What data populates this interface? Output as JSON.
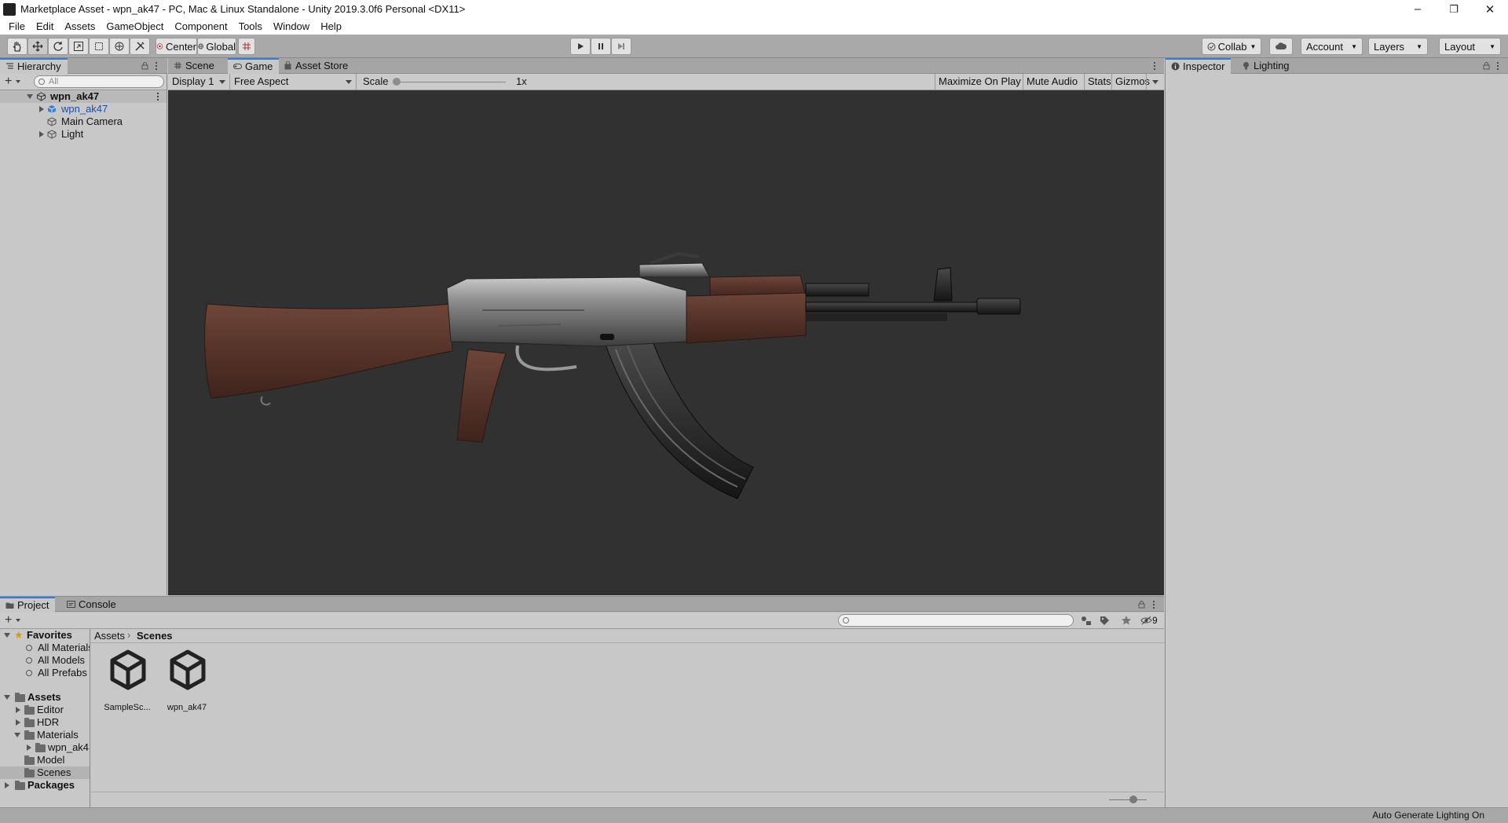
{
  "window": {
    "title": "Marketplace Asset - wpn_ak47 - PC, Mac & Linux Standalone - Unity 2019.3.0f6 Personal <DX11>",
    "controls": {
      "minimize": "–",
      "maximize": "❐",
      "close": "✕"
    }
  },
  "menu": [
    "File",
    "Edit",
    "Assets",
    "GameObject",
    "Component",
    "Tools",
    "Window",
    "Help"
  ],
  "toolbar": {
    "pivot_mode": "Center",
    "pivot_rotation": "Global",
    "collab": "Collab",
    "account": "Account",
    "layers": "Layers",
    "layout": "Layout"
  },
  "hierarchy": {
    "tab": "Hierarchy",
    "search_placeholder": "All",
    "scene": "wpn_ak47",
    "items": [
      {
        "label": "wpn_ak47",
        "prefab": true,
        "expandable": true
      },
      {
        "label": "Main Camera",
        "prefab": false,
        "expandable": false
      },
      {
        "label": "Light",
        "prefab": false,
        "expandable": true
      }
    ]
  },
  "center_tabs": [
    "Scene",
    "Game",
    "Asset Store"
  ],
  "center_active_tab": "Game",
  "game_toolbar": {
    "display": "Display 1",
    "aspect": "Free Aspect",
    "scale_label": "Scale",
    "scale_value": "1x",
    "maximize_on_play": "Maximize On Play",
    "mute_audio": "Mute Audio",
    "stats": "Stats",
    "gizmos": "Gizmos"
  },
  "right_tabs": [
    "Inspector",
    "Lighting"
  ],
  "project": {
    "tabs": [
      "Project",
      "Console"
    ],
    "hidden_count": "9",
    "favorites": {
      "label": "Favorites",
      "items": [
        "All Materials",
        "All Models",
        "All Prefabs"
      ]
    },
    "assets": {
      "label": "Assets",
      "folders": [
        {
          "label": "Editor",
          "children": []
        },
        {
          "label": "HDR",
          "children": []
        },
        {
          "label": "Materials",
          "children": [
            "wpn_ak4"
          ]
        },
        {
          "label": "Model",
          "children": []
        },
        {
          "label": "Scenes",
          "children": [],
          "selected": true
        }
      ]
    },
    "packages": "Packages",
    "breadcrumb": [
      "Assets",
      "Scenes"
    ],
    "files": [
      "SampleSc...",
      "wpn_ak47"
    ]
  },
  "status": {
    "right": "Auto Generate Lighting On"
  },
  "colors": {
    "accent": "#3a79d8",
    "game_bg": "#313131",
    "panel_bg": "#c8c8c8",
    "prefab_text": "#1a4fa8"
  }
}
